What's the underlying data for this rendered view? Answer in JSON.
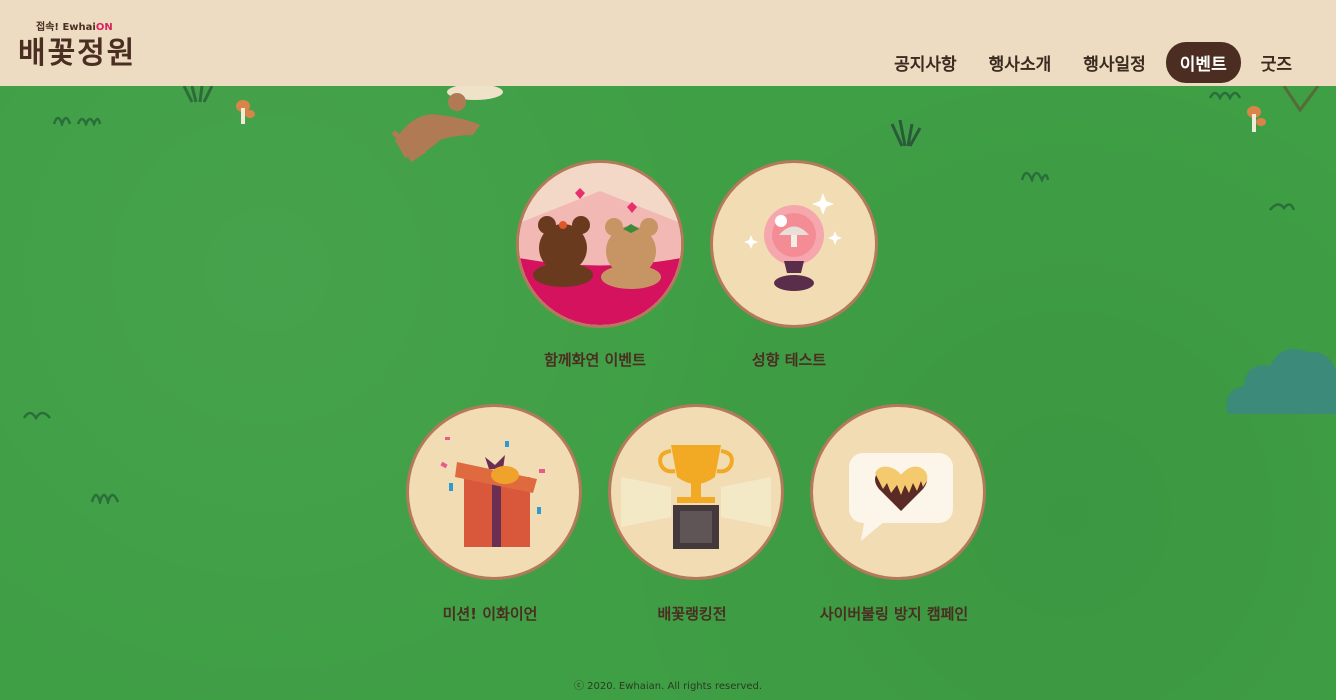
{
  "header": {
    "logo_sub_prefix": "접속! Ewhai",
    "logo_sub_on": "ON",
    "logo_main": "배꽃정원",
    "nav": [
      {
        "label": "공지사항"
      },
      {
        "label": "행사소개"
      },
      {
        "label": "행사일정"
      },
      {
        "label": "이벤트"
      },
      {
        "label": "굿즈"
      }
    ]
  },
  "events": [
    {
      "label": "함께화연 이벤트",
      "icon": "bears-icon"
    },
    {
      "label": "성향 테스트",
      "icon": "crystal-ball-icon"
    },
    {
      "label": "미션! 이화이언",
      "icon": "gift-box-icon"
    },
    {
      "label": "배꽃랭킹전",
      "icon": "trophy-icon"
    },
    {
      "label": "사이버불링 방지 캠페인",
      "icon": "heart-speech-bubble-icon"
    }
  ],
  "footer": {
    "text": "ⓒ 2020. Ewhaian. All rights reserved."
  },
  "colors": {
    "header_bg": "#eddcc2",
    "grass": "#3f9f45",
    "active_nav": "#4b2d22",
    "circle_bg": "#f2dcb4"
  }
}
